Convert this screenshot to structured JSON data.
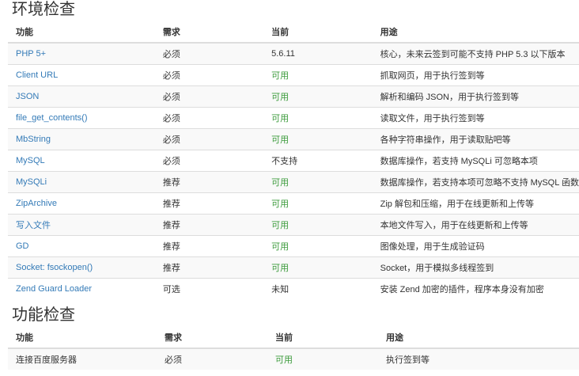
{
  "env_section": {
    "title": "环境检查",
    "headers": {
      "name": "功能",
      "requirement": "需求",
      "current": "当前",
      "usage": "用途"
    },
    "rows": [
      {
        "name": "PHP 5+",
        "requirement": "必须",
        "current": "5.6.11",
        "current_status": "plain",
        "usage": "核心，未来云签到可能不支持 PHP 5.3 以下版本"
      },
      {
        "name": "Client URL",
        "requirement": "必须",
        "current": "可用",
        "current_status": "ok",
        "usage": "抓取网页，用于执行签到等"
      },
      {
        "name": "JSON",
        "requirement": "必须",
        "current": "可用",
        "current_status": "ok",
        "usage": "解析和编码 JSON，用于执行签到等"
      },
      {
        "name": "file_get_contents()",
        "requirement": "必须",
        "current": "可用",
        "current_status": "ok",
        "usage": "读取文件，用于执行签到等"
      },
      {
        "name": "MbString",
        "requirement": "必须",
        "current": "可用",
        "current_status": "ok",
        "usage": "各种字符串操作，用于读取贴吧等"
      },
      {
        "name": "MySQL",
        "requirement": "必须",
        "current": "不支持",
        "current_status": "plain",
        "usage": "数据库操作，若支持 MySQLi 可忽略本项"
      },
      {
        "name": "MySQLi",
        "requirement": "推荐",
        "current": "可用",
        "current_status": "ok",
        "usage": "数据库操作，若支持本项可忽略不支持 MySQL 函数"
      },
      {
        "name": "ZipArchive",
        "requirement": "推荐",
        "current": "可用",
        "current_status": "ok",
        "usage": "Zip 解包和压缩，用于在线更新和上传等"
      },
      {
        "name": "写入文件",
        "requirement": "推荐",
        "current": "可用",
        "current_status": "ok",
        "usage": "本地文件写入，用于在线更新和上传等"
      },
      {
        "name": "GD",
        "requirement": "推荐",
        "current": "可用",
        "current_status": "ok",
        "usage": "图像处理，用于生成验证码"
      },
      {
        "name": "Socket: fsockopen()",
        "requirement": "推荐",
        "current": "可用",
        "current_status": "ok",
        "usage": "Socket，用于模拟多线程签到"
      },
      {
        "name": "Zend Guard Loader",
        "requirement": "可选",
        "current": "未知",
        "current_status": "plain",
        "usage": "安装 Zend 加密的插件，程序本身没有加密"
      }
    ]
  },
  "func_section": {
    "title": "功能检查",
    "headers": {
      "name": "功能",
      "requirement": "需求",
      "current": "当前",
      "usage": "用途"
    },
    "rows": [
      {
        "name": "连接百度服务器",
        "requirement": "必须",
        "current": "可用",
        "current_status": "ok",
        "usage": "执行签到等"
      }
    ]
  },
  "colors": {
    "link": "#337ab7",
    "ok": "#3c9b3c",
    "stripe": "#f9f9f9",
    "border": "#dddddd"
  }
}
